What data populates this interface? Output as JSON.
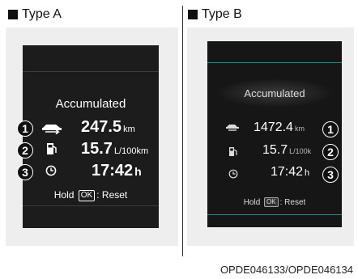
{
  "type_a": {
    "label": "Type A",
    "screen": {
      "title": "Accumulated",
      "rows": [
        {
          "badge": "1",
          "icon": "car-distance-icon",
          "value": "247.5",
          "unit": "km"
        },
        {
          "badge": "2",
          "icon": "fuel-pump-icon",
          "value": "15.7",
          "unit": "L/100km"
        },
        {
          "badge": "3",
          "icon": "clock-icon",
          "value": "17:42",
          "unit": "h"
        }
      ],
      "hold_prefix": "Hold",
      "ok_label": "OK",
      "hold_suffix": ": Reset"
    }
  },
  "type_b": {
    "label": "Type B",
    "screen": {
      "title": "Accumulated",
      "rows": [
        {
          "badge": "1",
          "icon": "car-distance-icon",
          "value": "1472.4",
          "unit": "km"
        },
        {
          "badge": "2",
          "icon": "fuel-pump-icon",
          "value": "15.7",
          "unit": "L/100k"
        },
        {
          "badge": "3",
          "icon": "clock-icon",
          "value": "17:42",
          "unit": "h"
        }
      ],
      "hold_prefix": "Hold",
      "ok_label": "OK",
      "hold_suffix": ": Reset"
    }
  },
  "footer_code": "OPDE046133/OPDE046134"
}
